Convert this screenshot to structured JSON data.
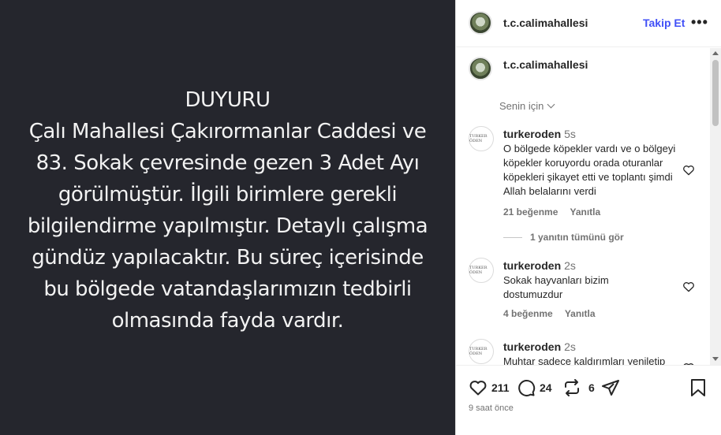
{
  "post": {
    "announcement_lines": [
      "DUYURU",
      "Çalı Mahallesi Çakırormanlar Caddesi ve",
      "83. Sokak çevresinde gezen 3 Adet Ayı",
      "görülmüştür. İlgili birimlere gerekli",
      "bilgilendirme yapılmıştır. Detaylı çalışma",
      "gündüz yapılacaktır. Bu süreç içerisinde",
      "bu bölgede vatandaşlarımızın tedbirli",
      "olmasında fayda vardır."
    ]
  },
  "header": {
    "username": "t.c.calimahallesi",
    "follow_label": "Takip Et",
    "more_label": "•••"
  },
  "caption": {
    "username": "t.c.calimahallesi",
    "for_you_label": "Senin için"
  },
  "comments": [
    {
      "avatar_text": "TURKER ÖDEN",
      "username": "turkeroden",
      "time": "5s",
      "text": "O bölgede köpekler vardı ve o bölgeyi köpekler koruyordu orada oturanlar köpekleri şikayet etti ve toplantı şimdi Allah belalarını verdi",
      "likes": "21 beğenme",
      "reply_label": "Yanıtla",
      "view_replies": "1 yanıtın tümünü gör"
    },
    {
      "avatar_text": "TURKER ÖDEN",
      "username": "turkeroden",
      "time": "2s",
      "text": "Sokak hayvanları bizim dostumuzdur",
      "likes": "4 beğenme",
      "reply_label": "Yanıtla"
    },
    {
      "avatar_text": "TURKER ÖDEN",
      "username": "turkeroden",
      "time": "2s",
      "text": "Muhtar sadece kaldırımları yeniletip"
    }
  ],
  "actions": {
    "likes_count": "211",
    "comments_count": "24",
    "reposts_count": "6",
    "posted_ago": "9 saat önce"
  },
  "icons": {
    "heart": "heart-icon",
    "comment": "comment-icon",
    "repost": "repost-icon",
    "share": "share-icon",
    "save": "bookmark-icon"
  },
  "colors": {
    "media_bg": "#25262d",
    "follow": "#4150f7"
  }
}
